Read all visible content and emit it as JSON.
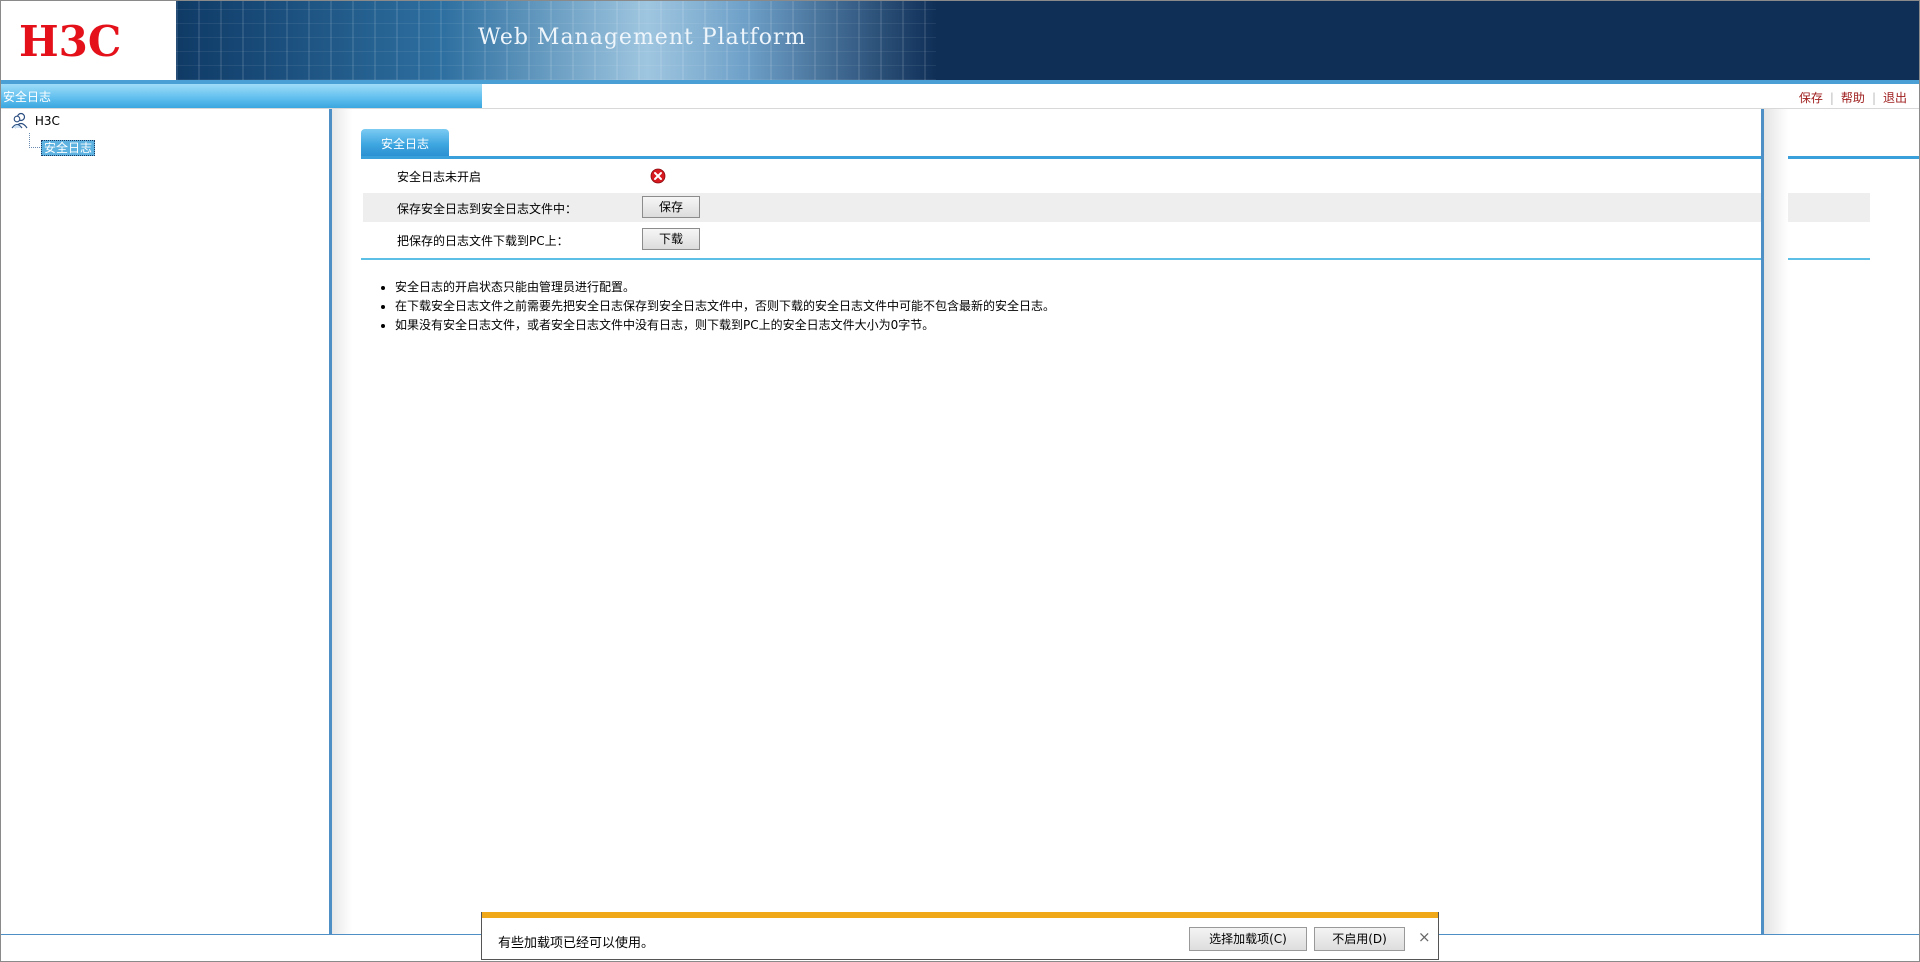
{
  "header": {
    "logo_text": "H3C",
    "platform_title": "Web Management Platform",
    "brand_color": "#e4111b"
  },
  "titlebar": {
    "title": "安全日志",
    "links": {
      "save": "保存",
      "help": "帮助",
      "logout": "退出"
    }
  },
  "sidebar": {
    "root": {
      "label": "H3C",
      "icon": "user-group-icon"
    },
    "child": {
      "label": "安全日志"
    }
  },
  "main": {
    "tab_label": "安全日志",
    "rows": [
      {
        "label": "安全日志未开启",
        "status_icon": "error-icon"
      },
      {
        "label": "保存安全日志到安全日志文件中：",
        "button": "保存"
      },
      {
        "label": "把保存的日志文件下载到PC上：",
        "button": "下载"
      }
    ],
    "notes": [
      "安全日志的开启状态只能由管理员进行配置。",
      "在下载安全日志文件之前需要先把安全日志保存到安全日志文件中，否则下载的安全日志文件中可能不包含最新的安全日志。",
      "如果没有安全日志文件，或者安全日志文件中没有日志，则下载到PC上的安全日志文件大小为0字节。"
    ]
  },
  "notification": {
    "message": "有些加载项已经可以使用。",
    "choose_button": "选择加载项(C)",
    "disable_button": "不启用(D)",
    "close": "×",
    "accent_color": "#f0a818"
  }
}
